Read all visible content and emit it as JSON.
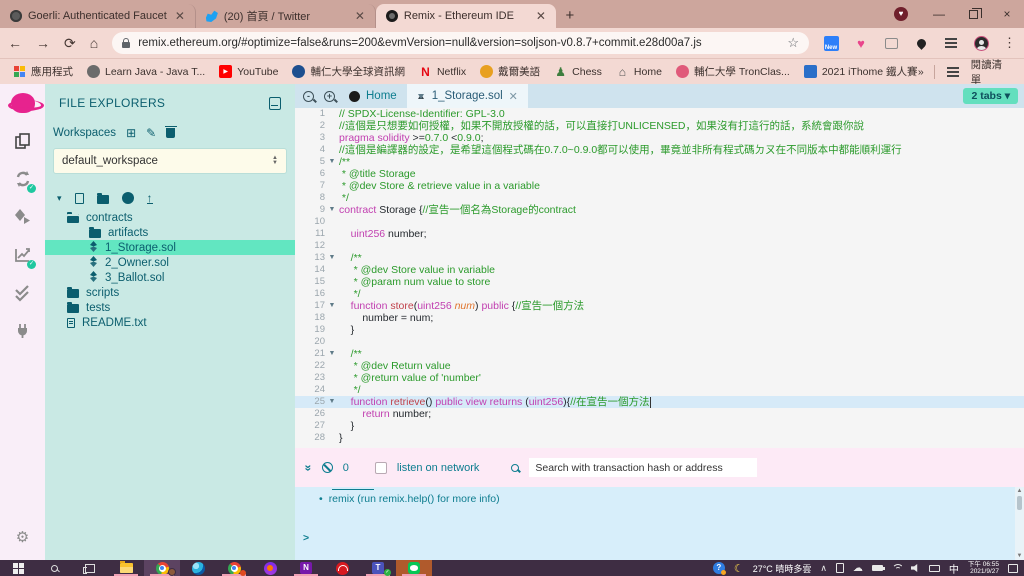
{
  "browser": {
    "tabs": [
      {
        "title": "Goerli: Authenticated Faucet",
        "icon": "globe",
        "active": false
      },
      {
        "title": "(20) 首頁 / Twitter",
        "icon": "twitter",
        "active": false
      },
      {
        "title": "Remix - Ethereum IDE",
        "icon": "remix",
        "active": true
      }
    ],
    "new_tab_label": "+",
    "window_controls": {
      "minimize": "—",
      "close": "×"
    },
    "url": "remix.ethereum.org/#optimize=false&runs=200&evmVersion=null&version=soljson-v0.8.7+commit.e28d00a7.js",
    "extension_new_label": "New",
    "bookmarks": [
      {
        "label": "應用程式",
        "icon": "grid"
      },
      {
        "label": "Learn Java - Java T...",
        "icon": "circle",
        "color": "#6b6b6b"
      },
      {
        "label": "YouTube",
        "icon": "youtube",
        "color": "#ff0000"
      },
      {
        "label": "輔仁大學全球資訊網",
        "icon": "circle",
        "color": "#1d4f8f"
      },
      {
        "label": "Netflix",
        "icon": "letter",
        "color": "#e50914",
        "text": "N"
      },
      {
        "label": "戴爾美語",
        "icon": "circle",
        "color": "#e8a020"
      },
      {
        "label": "Chess",
        "icon": "pawn",
        "color": "#3e7d3e"
      },
      {
        "label": "Home",
        "icon": "house",
        "color": "#555555"
      },
      {
        "label": "輔仁大學 TronClas...",
        "icon": "circle",
        "color": "#e05a7a"
      },
      {
        "label": "2021 iThome 鐵人賽",
        "icon": "square",
        "color": "#2a6fc9"
      }
    ],
    "bookmarks_overflow": "»",
    "reading_list_label": "閱讀清單"
  },
  "remix": {
    "rail": [
      {
        "name": "remix-logo",
        "kind": "logo"
      },
      {
        "name": "file-explorer-icon",
        "kind": "files"
      },
      {
        "name": "solidity-compiler-icon",
        "kind": "compiler",
        "badge": true
      },
      {
        "name": "deploy-run-icon",
        "kind": "deploy"
      },
      {
        "name": "analysis-chart-icon",
        "kind": "chart",
        "badge": true
      },
      {
        "name": "static-analysis-icon",
        "kind": "checks"
      },
      {
        "name": "plugin-manager-icon",
        "kind": "plug"
      }
    ],
    "file_panel": {
      "title": "FILE EXPLORERS",
      "workspaces_label": "Workspaces",
      "workspace_selected": "default_workspace",
      "tree": [
        {
          "label": "contracts",
          "icon": "folder-open",
          "depth": 0,
          "selected": false
        },
        {
          "label": "artifacts",
          "icon": "folder",
          "depth": 1,
          "selected": false
        },
        {
          "label": "1_Storage.sol",
          "icon": "solidity",
          "depth": 1,
          "selected": true
        },
        {
          "label": "2_Owner.sol",
          "icon": "solidity",
          "depth": 1,
          "selected": false
        },
        {
          "label": "3_Ballot.sol",
          "icon": "solidity",
          "depth": 1,
          "selected": false
        },
        {
          "label": "scripts",
          "icon": "folder",
          "depth": 0,
          "selected": false
        },
        {
          "label": "tests",
          "icon": "folder",
          "depth": 0,
          "selected": false
        },
        {
          "label": "README.txt",
          "icon": "file",
          "depth": 0,
          "selected": false
        }
      ]
    },
    "editor": {
      "home_tab": "Home",
      "file_tab": "1_Storage.sol",
      "tabs_pill": "2 tabs ▾",
      "code_lines": [
        {
          "n": 1,
          "t": [
            [
              "cm",
              "// SPDX-License-Identifier: GPL-3.0"
            ]
          ]
        },
        {
          "n": 2,
          "t": [
            [
              "cm",
              "//這個是只想要如何授權，如果不開放授權的話，可以直接打UNLICENSED，如果沒有打這行的話，系統會跟你說"
            ]
          ]
        },
        {
          "n": 3,
          "t": [
            [
              "kw",
              "pragma"
            ],
            [
              "pl",
              " "
            ],
            [
              "kw",
              "solidity"
            ],
            [
              "pl",
              " >="
            ],
            [
              "nm",
              "0.7.0"
            ],
            [
              "pl",
              " <"
            ],
            [
              "nm",
              "0.9.0"
            ],
            [
              "pl",
              ";"
            ]
          ]
        },
        {
          "n": 4,
          "t": [
            [
              "cm",
              "//這個是編譯器的設定，是希望這個程式碼在0.7.0~0.9.0都可以使用，畢竟並非所有程式碼ㄉㄡ在不同版本中都能順利運行"
            ]
          ]
        },
        {
          "n": 5,
          "fold": true,
          "t": [
            [
              "cm",
              "/**"
            ]
          ]
        },
        {
          "n": 6,
          "t": [
            [
              "cm",
              " * @title Storage"
            ]
          ]
        },
        {
          "n": 7,
          "t": [
            [
              "cm",
              " * @dev Store & retrieve value in a variable"
            ]
          ]
        },
        {
          "n": 8,
          "t": [
            [
              "cm",
              " */"
            ]
          ]
        },
        {
          "n": 9,
          "fold": true,
          "t": [
            [
              "kw",
              "contract"
            ],
            [
              "pl",
              " Storage {"
            ],
            [
              "cm",
              "//宣告一個名為Storage的contract"
            ]
          ]
        },
        {
          "n": 10,
          "t": []
        },
        {
          "n": 11,
          "t": [
            [
              "pl",
              "    "
            ],
            [
              "kw",
              "uint256"
            ],
            [
              "pl",
              " number;"
            ]
          ]
        },
        {
          "n": 12,
          "t": []
        },
        {
          "n": 13,
          "fold": true,
          "t": [
            [
              "pl",
              "    "
            ],
            [
              "cm",
              "/**"
            ]
          ]
        },
        {
          "n": 14,
          "t": [
            [
              "pl",
              "    "
            ],
            [
              "cm",
              " * @dev Store value in variable"
            ]
          ]
        },
        {
          "n": 15,
          "t": [
            [
              "pl",
              "    "
            ],
            [
              "cm",
              " * @param num value to store"
            ]
          ]
        },
        {
          "n": 16,
          "t": [
            [
              "pl",
              "    "
            ],
            [
              "cm",
              " */"
            ]
          ]
        },
        {
          "n": 17,
          "fold": true,
          "t": [
            [
              "pl",
              "    "
            ],
            [
              "kw",
              "function"
            ],
            [
              "pl",
              " "
            ],
            [
              "fn",
              "store"
            ],
            [
              "pl",
              "("
            ],
            [
              "kw",
              "uint256"
            ],
            [
              "pl",
              " "
            ],
            [
              "pm",
              "num"
            ],
            [
              "pl",
              ") "
            ],
            [
              "kw",
              "public"
            ],
            [
              "pl",
              " {"
            ],
            [
              "cm",
              "//宣告一個方法"
            ]
          ]
        },
        {
          "n": 18,
          "t": [
            [
              "pl",
              "        number "
            ],
            [
              "pl",
              "="
            ],
            [
              "pl",
              " num;"
            ]
          ]
        },
        {
          "n": 19,
          "t": [
            [
              "pl",
              "    }"
            ]
          ]
        },
        {
          "n": 20,
          "t": []
        },
        {
          "n": 21,
          "fold": true,
          "t": [
            [
              "pl",
              "    "
            ],
            [
              "cm",
              "/**"
            ]
          ]
        },
        {
          "n": 22,
          "t": [
            [
              "pl",
              "    "
            ],
            [
              "cm",
              " * @dev Return value"
            ]
          ]
        },
        {
          "n": 23,
          "t": [
            [
              "pl",
              "    "
            ],
            [
              "cm",
              " * @return value of 'number'"
            ]
          ]
        },
        {
          "n": 24,
          "t": [
            [
              "pl",
              "    "
            ],
            [
              "cm",
              " */"
            ]
          ]
        },
        {
          "n": 25,
          "fold": true,
          "cur": true,
          "t": [
            [
              "pl",
              "    "
            ],
            [
              "kw",
              "function"
            ],
            [
              "pl",
              " "
            ],
            [
              "fn",
              "retrieve"
            ],
            [
              "pl",
              "() "
            ],
            [
              "kw",
              "public"
            ],
            [
              "pl",
              " "
            ],
            [
              "kw",
              "view"
            ],
            [
              "pl",
              " "
            ],
            [
              "kw",
              "returns"
            ],
            [
              "pl",
              " ("
            ],
            [
              "kw",
              "uint256"
            ],
            [
              "pl",
              "){"
            ],
            [
              "cm",
              "//在宣告一個方法"
            ]
          ]
        },
        {
          "n": 26,
          "t": [
            [
              "pl",
              "        "
            ],
            [
              "kw",
              "return"
            ],
            [
              "pl",
              " number;"
            ]
          ]
        },
        {
          "n": 27,
          "t": [
            [
              "pl",
              "    }"
            ]
          ]
        },
        {
          "n": 28,
          "t": [
            [
              "pl",
              "}"
            ]
          ]
        }
      ]
    },
    "terminal": {
      "badge": "0",
      "listen_label": "listen on network",
      "search_placeholder": "Search with transaction hash or address",
      "log_line": "remix (run remix.help() for more info)",
      "prompt": ">"
    }
  },
  "taskbar": {
    "apps": [
      {
        "name": "start-button",
        "kind": "start"
      },
      {
        "name": "search-button",
        "kind": "search"
      },
      {
        "name": "task-view-button",
        "kind": "taskview"
      },
      {
        "name": "file-explorer-app",
        "kind": "folder",
        "underline": true
      },
      {
        "name": "chrome-profile-1",
        "kind": "chrome",
        "avatar": true,
        "hl": true,
        "underline": true
      },
      {
        "name": "edge-app",
        "kind": "edge"
      },
      {
        "name": "chrome-profile-2",
        "kind": "chrome",
        "badge": true,
        "underline": true
      },
      {
        "name": "avast-browser-app",
        "kind": "avast"
      },
      {
        "name": "onenote-app",
        "kind": "onenote",
        "underline": true
      },
      {
        "name": "trend-micro-app",
        "kind": "trend"
      },
      {
        "name": "teams-app",
        "kind": "teams",
        "check": true,
        "underline": true
      },
      {
        "name": "line-app",
        "kind": "line",
        "hlorange": true,
        "underline": true
      }
    ],
    "weather_temp": "27°C",
    "weather_desc": "晴時多雲",
    "ime": "中",
    "time": "下午 06:55",
    "date": "2021/9/27"
  }
}
